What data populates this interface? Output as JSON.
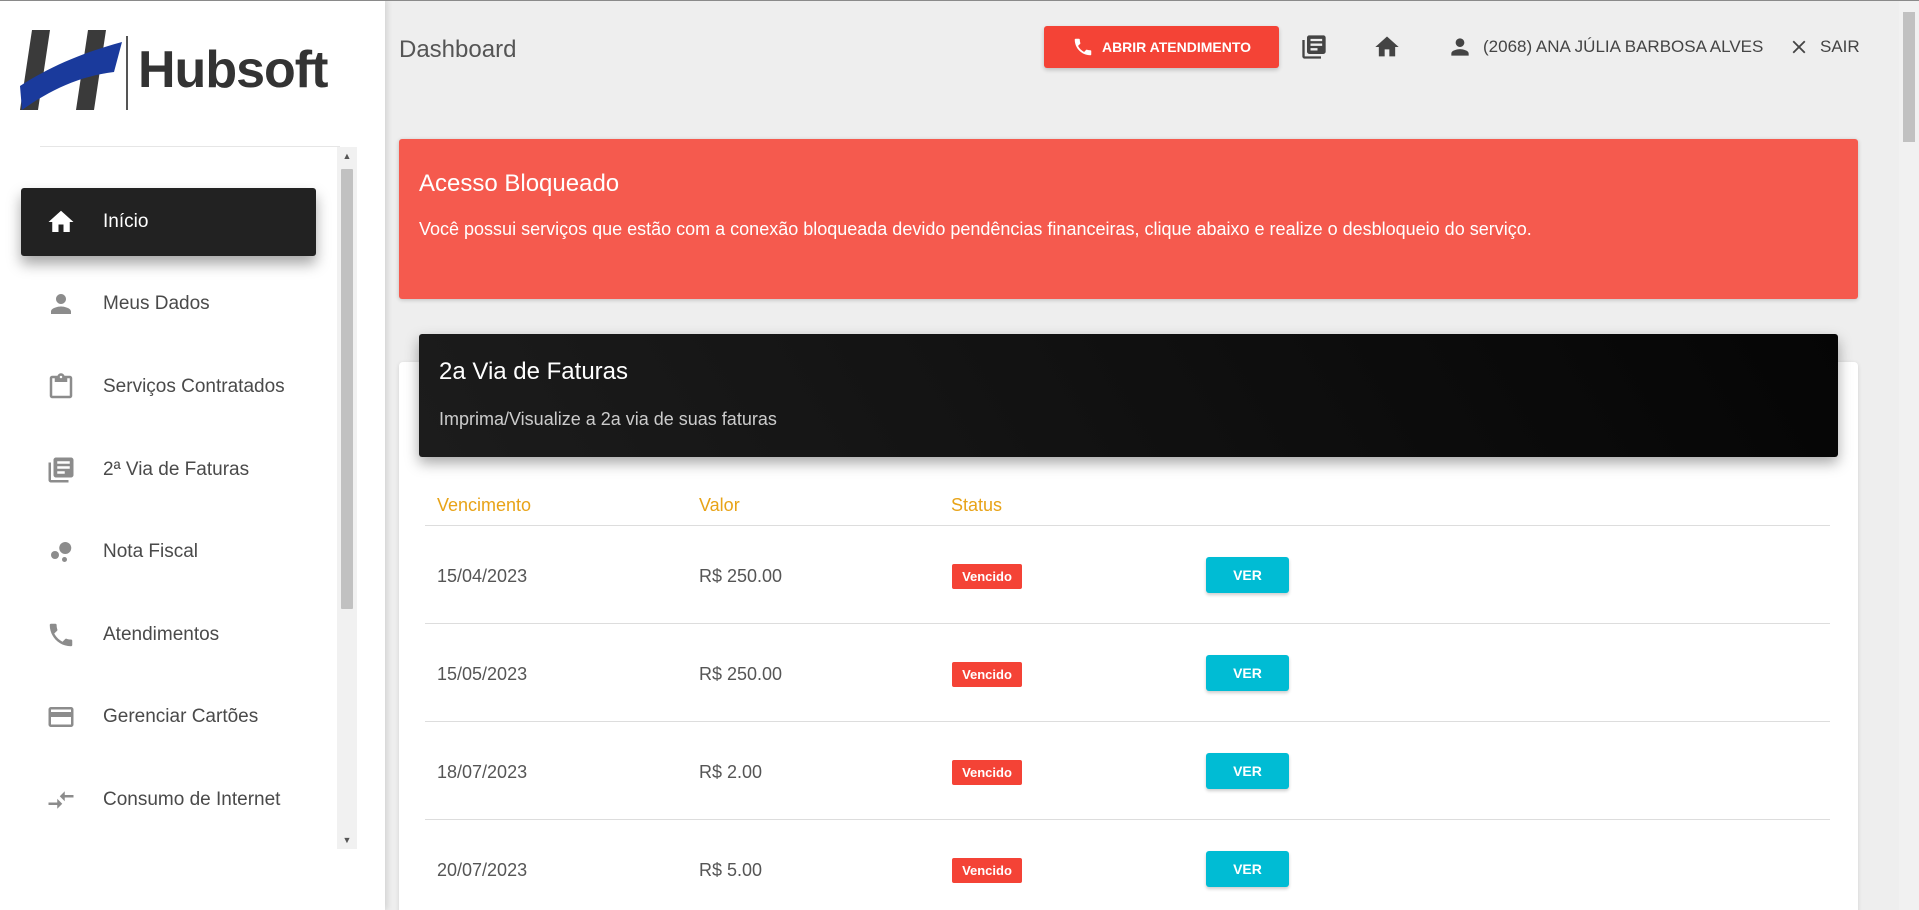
{
  "brand": {
    "logo_text": "Hubsoft",
    "colors": {
      "blue": "#1a3a9c",
      "dark": "#333333"
    }
  },
  "header": {
    "title": "Dashboard",
    "atendimento_label": "ABRIR ATENDIMENTO",
    "user_label": "(2068) ANA JÚLIA BARBOSA ALVES",
    "logout_label": "SAIR"
  },
  "sidebar": {
    "items": [
      {
        "label": "Início",
        "icon": "home-icon",
        "active": true
      },
      {
        "label": "Meus Dados",
        "icon": "person-icon"
      },
      {
        "label": "Serviços Contratados",
        "icon": "clipboard-icon"
      },
      {
        "label": "2ª Via de Faturas",
        "icon": "library-books-icon"
      },
      {
        "label": "Nota Fiscal",
        "icon": "bubble-chart-icon"
      },
      {
        "label": "Atendimentos",
        "icon": "phone-icon"
      },
      {
        "label": "Gerenciar Cartões",
        "icon": "credit-card-icon"
      },
      {
        "label": "Consumo de Internet",
        "icon": "compare-arrows-icon"
      }
    ]
  },
  "alert": {
    "title": "Acesso Bloqueado",
    "text": "Você possui serviços que estão com a conexão bloqueada devido pendências financeiras, clique abaixo e realize o desbloqueio do serviço.",
    "color": "#f55a4e"
  },
  "invoices": {
    "title": "2a Via de Faturas",
    "subtitle": "Imprima/Visualize a 2a via de suas faturas",
    "columns": [
      "Vencimento",
      "Valor",
      "Status"
    ],
    "rows": [
      {
        "due": "15/04/2023",
        "value": "R$ 250.00",
        "status": "Vencido",
        "action": "VER"
      },
      {
        "due": "15/05/2023",
        "value": "R$ 250.00",
        "status": "Vencido",
        "action": "VER"
      },
      {
        "due": "18/07/2023",
        "value": "R$ 2.00",
        "status": "Vencido",
        "action": "VER"
      },
      {
        "due": "20/07/2023",
        "value": "R$ 5.00",
        "status": "Vencido",
        "action": "VER"
      }
    ]
  }
}
